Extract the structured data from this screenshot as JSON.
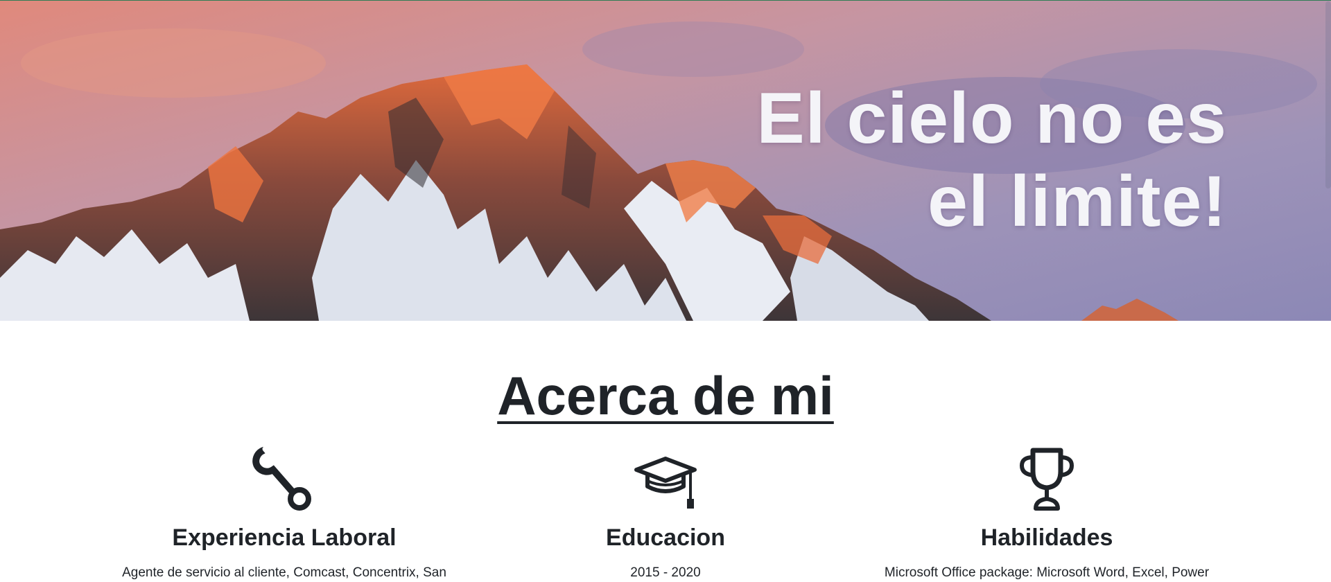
{
  "hero": {
    "title_line1": "El cielo no es",
    "title_line2": "el limite!"
  },
  "about": {
    "title": "Acerca de mi",
    "columns": [
      {
        "icon": "wrench-icon",
        "heading": "Experiencia Laboral",
        "text": "Agente de servicio al cliente, Comcast, Concentrix, San"
      },
      {
        "icon": "graduation-cap-icon",
        "heading": "Educacion",
        "text": "2015 - 2020"
      },
      {
        "icon": "trophy-icon",
        "heading": "Habilidades",
        "text": "Microsoft Office package: Microsoft Word, Excel, Power"
      }
    ]
  },
  "colors": {
    "text": "#1f2328",
    "hero_text": "#f4f4f8",
    "sky_top": "#c98a8c",
    "sky_bottom": "#8a86b2"
  }
}
